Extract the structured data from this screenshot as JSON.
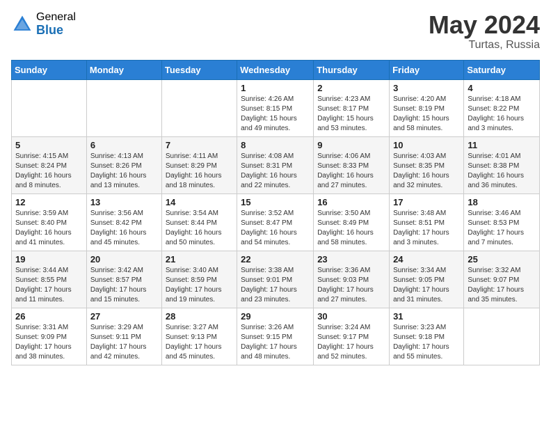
{
  "header": {
    "logo_general": "General",
    "logo_blue": "Blue",
    "month_year": "May 2024",
    "location": "Turtas, Russia"
  },
  "weekdays": [
    "Sunday",
    "Monday",
    "Tuesday",
    "Wednesday",
    "Thursday",
    "Friday",
    "Saturday"
  ],
  "weeks": [
    [
      {
        "day": "",
        "info": ""
      },
      {
        "day": "",
        "info": ""
      },
      {
        "day": "",
        "info": ""
      },
      {
        "day": "1",
        "info": "Sunrise: 4:26 AM\nSunset: 8:15 PM\nDaylight: 15 hours and 49 minutes."
      },
      {
        "day": "2",
        "info": "Sunrise: 4:23 AM\nSunset: 8:17 PM\nDaylight: 15 hours and 53 minutes."
      },
      {
        "day": "3",
        "info": "Sunrise: 4:20 AM\nSunset: 8:19 PM\nDaylight: 15 hours and 58 minutes."
      },
      {
        "day": "4",
        "info": "Sunrise: 4:18 AM\nSunset: 8:22 PM\nDaylight: 16 hours and 3 minutes."
      }
    ],
    [
      {
        "day": "5",
        "info": "Sunrise: 4:15 AM\nSunset: 8:24 PM\nDaylight: 16 hours and 8 minutes."
      },
      {
        "day": "6",
        "info": "Sunrise: 4:13 AM\nSunset: 8:26 PM\nDaylight: 16 hours and 13 minutes."
      },
      {
        "day": "7",
        "info": "Sunrise: 4:11 AM\nSunset: 8:29 PM\nDaylight: 16 hours and 18 minutes."
      },
      {
        "day": "8",
        "info": "Sunrise: 4:08 AM\nSunset: 8:31 PM\nDaylight: 16 hours and 22 minutes."
      },
      {
        "day": "9",
        "info": "Sunrise: 4:06 AM\nSunset: 8:33 PM\nDaylight: 16 hours and 27 minutes."
      },
      {
        "day": "10",
        "info": "Sunrise: 4:03 AM\nSunset: 8:35 PM\nDaylight: 16 hours and 32 minutes."
      },
      {
        "day": "11",
        "info": "Sunrise: 4:01 AM\nSunset: 8:38 PM\nDaylight: 16 hours and 36 minutes."
      }
    ],
    [
      {
        "day": "12",
        "info": "Sunrise: 3:59 AM\nSunset: 8:40 PM\nDaylight: 16 hours and 41 minutes."
      },
      {
        "day": "13",
        "info": "Sunrise: 3:56 AM\nSunset: 8:42 PM\nDaylight: 16 hours and 45 minutes."
      },
      {
        "day": "14",
        "info": "Sunrise: 3:54 AM\nSunset: 8:44 PM\nDaylight: 16 hours and 50 minutes."
      },
      {
        "day": "15",
        "info": "Sunrise: 3:52 AM\nSunset: 8:47 PM\nDaylight: 16 hours and 54 minutes."
      },
      {
        "day": "16",
        "info": "Sunrise: 3:50 AM\nSunset: 8:49 PM\nDaylight: 16 hours and 58 minutes."
      },
      {
        "day": "17",
        "info": "Sunrise: 3:48 AM\nSunset: 8:51 PM\nDaylight: 17 hours and 3 minutes."
      },
      {
        "day": "18",
        "info": "Sunrise: 3:46 AM\nSunset: 8:53 PM\nDaylight: 17 hours and 7 minutes."
      }
    ],
    [
      {
        "day": "19",
        "info": "Sunrise: 3:44 AM\nSunset: 8:55 PM\nDaylight: 17 hours and 11 minutes."
      },
      {
        "day": "20",
        "info": "Sunrise: 3:42 AM\nSunset: 8:57 PM\nDaylight: 17 hours and 15 minutes."
      },
      {
        "day": "21",
        "info": "Sunrise: 3:40 AM\nSunset: 8:59 PM\nDaylight: 17 hours and 19 minutes."
      },
      {
        "day": "22",
        "info": "Sunrise: 3:38 AM\nSunset: 9:01 PM\nDaylight: 17 hours and 23 minutes."
      },
      {
        "day": "23",
        "info": "Sunrise: 3:36 AM\nSunset: 9:03 PM\nDaylight: 17 hours and 27 minutes."
      },
      {
        "day": "24",
        "info": "Sunrise: 3:34 AM\nSunset: 9:05 PM\nDaylight: 17 hours and 31 minutes."
      },
      {
        "day": "25",
        "info": "Sunrise: 3:32 AM\nSunset: 9:07 PM\nDaylight: 17 hours and 35 minutes."
      }
    ],
    [
      {
        "day": "26",
        "info": "Sunrise: 3:31 AM\nSunset: 9:09 PM\nDaylight: 17 hours and 38 minutes."
      },
      {
        "day": "27",
        "info": "Sunrise: 3:29 AM\nSunset: 9:11 PM\nDaylight: 17 hours and 42 minutes."
      },
      {
        "day": "28",
        "info": "Sunrise: 3:27 AM\nSunset: 9:13 PM\nDaylight: 17 hours and 45 minutes."
      },
      {
        "day": "29",
        "info": "Sunrise: 3:26 AM\nSunset: 9:15 PM\nDaylight: 17 hours and 48 minutes."
      },
      {
        "day": "30",
        "info": "Sunrise: 3:24 AM\nSunset: 9:17 PM\nDaylight: 17 hours and 52 minutes."
      },
      {
        "day": "31",
        "info": "Sunrise: 3:23 AM\nSunset: 9:18 PM\nDaylight: 17 hours and 55 minutes."
      },
      {
        "day": "",
        "info": ""
      }
    ]
  ]
}
